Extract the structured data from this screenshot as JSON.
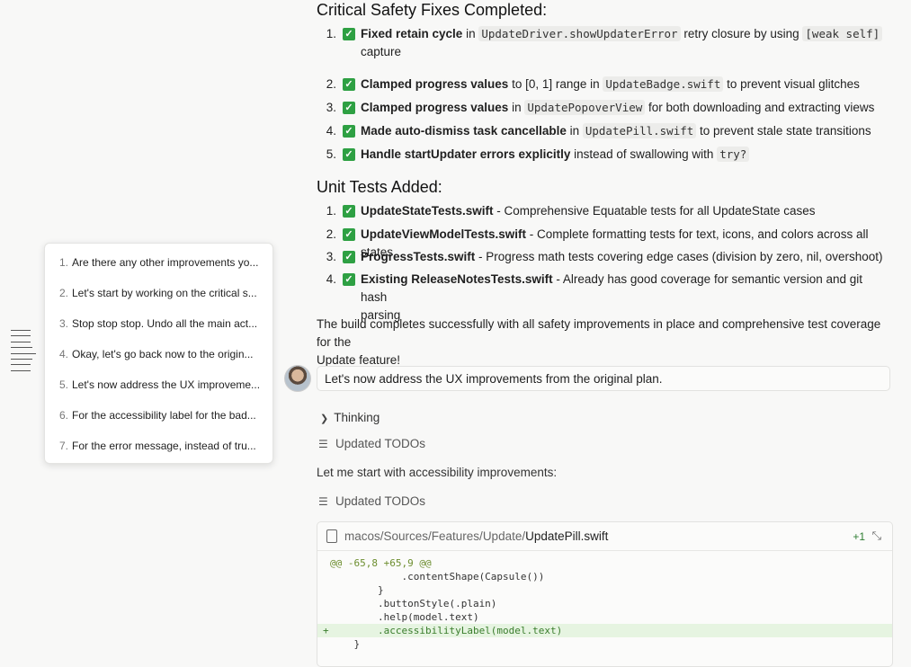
{
  "safety": {
    "heading": "Critical Safety Fixes Completed:",
    "items": [
      {
        "num": "1.",
        "bold": "Fixed retain cycle",
        "t1": " in ",
        "code1": "UpdateDriver.showUpdaterError",
        "t2": " retry closure by using ",
        "code2": "[weak self]",
        "t3": "capture"
      },
      {
        "num": "2.",
        "bold": "Clamped progress values",
        "t1": " to [0, 1] range in ",
        "code1": "UpdateBadge.swift",
        "t2": " to prevent visual glitches"
      },
      {
        "num": "3.",
        "bold": "Clamped progress values",
        "t1": " in ",
        "code1": "UpdatePopoverView",
        "t2": " for both downloading and extracting views"
      },
      {
        "num": "4.",
        "bold": "Made auto-dismiss task cancellable",
        "t1": " in ",
        "code1": "UpdatePill.swift",
        "t2": " to prevent stale state transitions"
      },
      {
        "num": "5.",
        "bold": "Handle startUpdater errors explicitly",
        "t1": " instead of swallowing with ",
        "code1": "try?"
      }
    ]
  },
  "tests": {
    "heading": "Unit Tests Added:",
    "items": [
      {
        "num": "1.",
        "bold": "UpdateStateTests.swift",
        "rest": " - Comprehensive Equatable tests for all UpdateState cases"
      },
      {
        "num": "2.",
        "bold": "UpdateViewModelTests.swift",
        "rest": " - Complete formatting tests for text, icons, and colors across all states"
      },
      {
        "num": "3.",
        "bold": "ProgressTests.swift",
        "rest": " - Progress math tests covering edge cases (division by zero, nil, overshoot)"
      },
      {
        "num": "4.",
        "bold": "Existing ReleaseNotesTests.swift",
        "rest": " - Already has good coverage for semantic version and git hash",
        "rest2": "parsing"
      }
    ]
  },
  "summary": {
    "line1": "The build completes successfully with all safety improvements in place and comprehensive test coverage for the",
    "line2": "Update feature!"
  },
  "user_message": "Let's now address the UX improvements from the original plan.",
  "thinking_label": "Thinking",
  "todos_label_1": "Updated TODOs",
  "assistant_text": "Let me start with accessibility improvements:",
  "todos_label_2": "Updated TODOs",
  "diff": {
    "path_prefix": "macos/Sources/Features/Update/",
    "file_name": "UpdatePill.swift",
    "added_count": "+1",
    "collapse_icon": "⤡",
    "lines": [
      {
        "kind": "hunk",
        "sign": "",
        "text": "@@ -65,8 +65,9 @@"
      },
      {
        "kind": "ctx",
        "sign": "",
        "text": "            .contentShape(Capsule())"
      },
      {
        "kind": "ctx",
        "sign": "",
        "text": "        }"
      },
      {
        "kind": "ctx",
        "sign": "",
        "text": "        .buttonStyle(.plain)"
      },
      {
        "kind": "ctx",
        "sign": "",
        "text": "        .help(model.text)"
      },
      {
        "kind": "add",
        "sign": "+",
        "text": "        .accessibilityLabel(model.text)"
      },
      {
        "kind": "ctx",
        "sign": "",
        "text": "    }"
      }
    ]
  },
  "history": [
    {
      "num": "1.",
      "text": "Are there any other improvements yo..."
    },
    {
      "num": "2.",
      "text": "Let's start by working on the critical s..."
    },
    {
      "num": "3.",
      "text": "Stop stop stop. Undo all the main act..."
    },
    {
      "num": "4.",
      "text": "Okay, let's go back now to the origin..."
    },
    {
      "num": "5.",
      "text": "Let's now address the UX improveme..."
    },
    {
      "num": "6.",
      "text": "For the accessibility label for the bad..."
    },
    {
      "num": "7.",
      "text": "For the error message, instead of tru..."
    }
  ]
}
